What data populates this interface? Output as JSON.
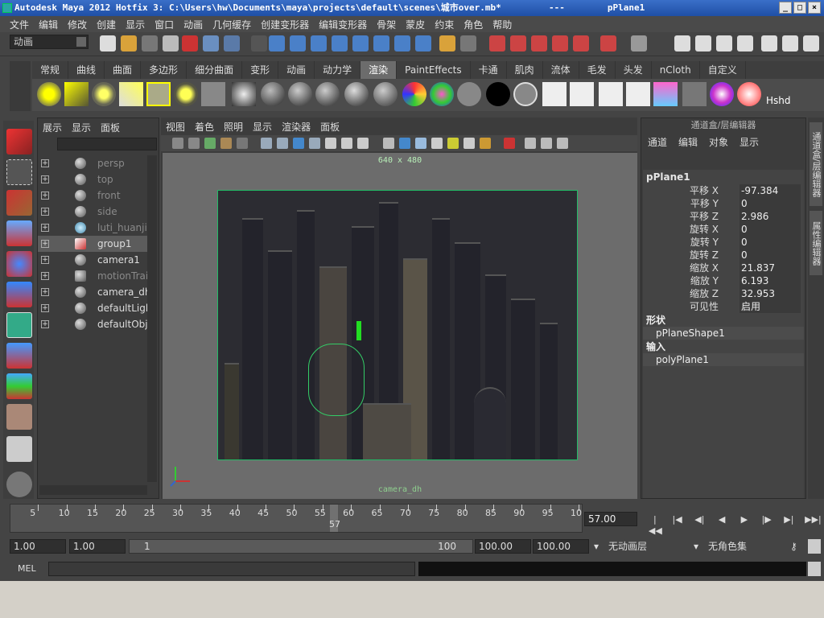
{
  "window": {
    "title": "Autodesk Maya 2012 Hotfix 3: C:\\Users\\hw\\Documents\\maya\\projects\\default\\scenes\\城市over.mb*",
    "title_separator": "---",
    "title_selection": "pPlane1",
    "controls": [
      "_",
      "□",
      "×"
    ]
  },
  "menus": [
    "文件",
    "编辑",
    "修改",
    "创建",
    "显示",
    "窗口",
    "动画",
    "几何缓存",
    "创建变形器",
    "编辑变形器",
    "骨架",
    "蒙皮",
    "约束",
    "角色",
    "帮助"
  ],
  "status_line": {
    "mode": "动画"
  },
  "shelf": {
    "tabs": [
      "常规",
      "曲线",
      "曲面",
      "多边形",
      "细分曲面",
      "变形",
      "动画",
      "动力学",
      "渲染",
      "PaintEffects",
      "卡通",
      "肌肉",
      "流体",
      "毛发",
      "头发",
      "nCloth",
      "自定义"
    ],
    "active_tab": "渲染",
    "last_icon_label": "Hshd"
  },
  "outliner": {
    "menu": [
      "展示",
      "显示",
      "面板"
    ],
    "items": [
      {
        "name": "persp",
        "dim": true
      },
      {
        "name": "top",
        "dim": true
      },
      {
        "name": "front",
        "dim": true
      },
      {
        "name": "side",
        "dim": true
      },
      {
        "name": "luti_huanji",
        "dim": true
      },
      {
        "name": "group1",
        "selected": true
      },
      {
        "name": "camera1"
      },
      {
        "name": "motionTrai",
        "dim": true
      },
      {
        "name": "camera_dh"
      },
      {
        "name": "defaultLigh"
      },
      {
        "name": "defaultObj"
      }
    ]
  },
  "viewport": {
    "menu": [
      "视图",
      "着色",
      "照明",
      "显示",
      "渲染器",
      "面板"
    ],
    "resolution": "640 x 480",
    "camera": "camera_dh"
  },
  "channel_box": {
    "title": "通道盒/层编辑器",
    "menu": [
      "通道",
      "编辑",
      "对象",
      "显示"
    ],
    "object": "pPlane1",
    "channels": [
      {
        "label": "平移 X",
        "value": "-97.384"
      },
      {
        "label": "平移 Y",
        "value": "0"
      },
      {
        "label": "平移 Z",
        "value": "2.986"
      },
      {
        "label": "旋转 X",
        "value": "0"
      },
      {
        "label": "旋转 Y",
        "value": "0"
      },
      {
        "label": "旋转 Z",
        "value": "0"
      },
      {
        "label": "缩放 X",
        "value": "21.837"
      },
      {
        "label": "缩放 Y",
        "value": "6.193"
      },
      {
        "label": "缩放 Z",
        "value": "32.953"
      },
      {
        "label": "可见性",
        "value": "启用"
      }
    ],
    "shapes_label": "形状",
    "shape": "pPlaneShape1",
    "inputs_label": "输入",
    "input": "polyPlane1",
    "side_tabs": [
      "通道盒/层编辑器",
      "属性编辑器"
    ]
  },
  "timeline": {
    "ticks": [
      "5",
      "10",
      "15",
      "20",
      "25",
      "30",
      "35",
      "40",
      "45",
      "50",
      "55",
      "60",
      "65",
      "70",
      "75",
      "80",
      "85",
      "90",
      "95",
      "10"
    ],
    "current_frame_marker": "57",
    "current_frame": "57.00"
  },
  "range": {
    "start": "1.00",
    "anim_start": "1.00",
    "slider_start": "1",
    "slider_end": "100",
    "anim_end": "100.00",
    "end": "100.00",
    "anim_layer": "无动画层",
    "char_set": "无角色集"
  },
  "command_line": {
    "label": "MEL"
  }
}
